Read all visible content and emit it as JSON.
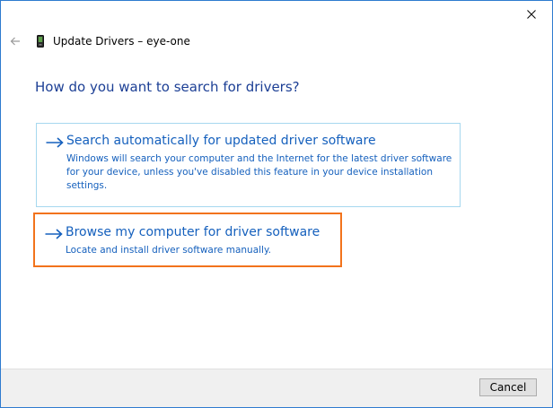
{
  "window": {
    "title": "Update Drivers – eye-one",
    "close_icon": "close-icon",
    "back_icon": "back-arrow-icon",
    "device_icon": "device-icon"
  },
  "main": {
    "heading": "How do you want to search for drivers?",
    "options": [
      {
        "title": "Search automatically for updated driver software",
        "description": "Windows will search your computer and the Internet for the latest driver software for your device, unless you've disabled this feature in your device installation settings.",
        "icon": "arrow-right-icon"
      },
      {
        "title": "Browse my computer for driver software",
        "description": "Locate and install driver software manually.",
        "icon": "arrow-right-icon",
        "highlighted": true
      }
    ]
  },
  "footer": {
    "cancel_label": "Cancel"
  },
  "colors": {
    "window_border": "#2e7bcf",
    "heading": "#1c3f95",
    "link_text": "#1560bd",
    "option_border": "#a6d8ef",
    "highlight_border": "#f2731c",
    "footer_bg": "#f0f0f0"
  }
}
